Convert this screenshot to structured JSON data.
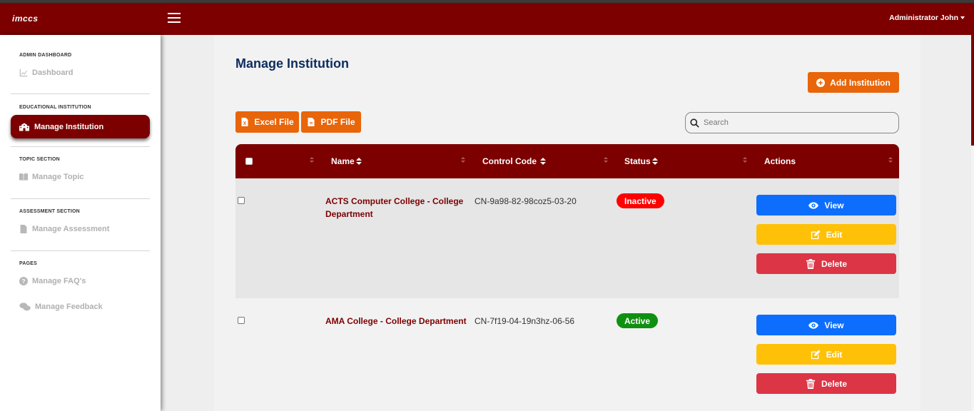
{
  "header": {
    "brand": "imccs",
    "user_name": "Administrator John"
  },
  "sidebar": {
    "sections": [
      {
        "title": "ADMIN DASHBOARD",
        "items": [
          {
            "label": "Dashboard",
            "icon": "chart-line-icon"
          }
        ]
      },
      {
        "title": "EDUCATIONAL INSTITUTION",
        "items": [
          {
            "label": "Manage Institution",
            "icon": "school-icon",
            "active": true
          }
        ]
      },
      {
        "title": "TOPIC SECTION",
        "items": [
          {
            "label": "Manage Topic",
            "icon": "book-open-icon"
          }
        ]
      },
      {
        "title": "ASSESSMENT SECTION",
        "items": [
          {
            "label": "Manage Assessment",
            "icon": "file-icon"
          }
        ]
      },
      {
        "title": "PAGES",
        "items": [
          {
            "label": "Manage FAQ's",
            "icon": "question-circle-icon"
          },
          {
            "label": "Manage Feedback",
            "icon": "comments-icon"
          }
        ]
      }
    ]
  },
  "main": {
    "title": "Manage Institution",
    "add_button": "Add Institution",
    "export_excel": "Excel File",
    "export_pdf": "PDF File",
    "search_placeholder": "Search"
  },
  "table": {
    "columns": [
      "Name",
      "Control Code",
      "Status",
      "Actions"
    ],
    "rows": [
      {
        "name": "ACTS Computer College - College Department",
        "control_code": "CN-9a98-82-98coz5-03-20",
        "status": "Inactive",
        "status_color": "#ff0000"
      },
      {
        "name": "AMA College - College Department",
        "control_code": "CN-7f19-04-19n3hz-06-56",
        "status": "Active",
        "status_color": "#109010"
      }
    ],
    "actions": {
      "view": "View",
      "edit": "Edit",
      "delete": "Delete"
    }
  },
  "colors": {
    "brand": "#7d0000",
    "accent_orange": "#e8650a",
    "view": "#0d6efd",
    "edit": "#ffc107",
    "delete": "#dc3545"
  }
}
